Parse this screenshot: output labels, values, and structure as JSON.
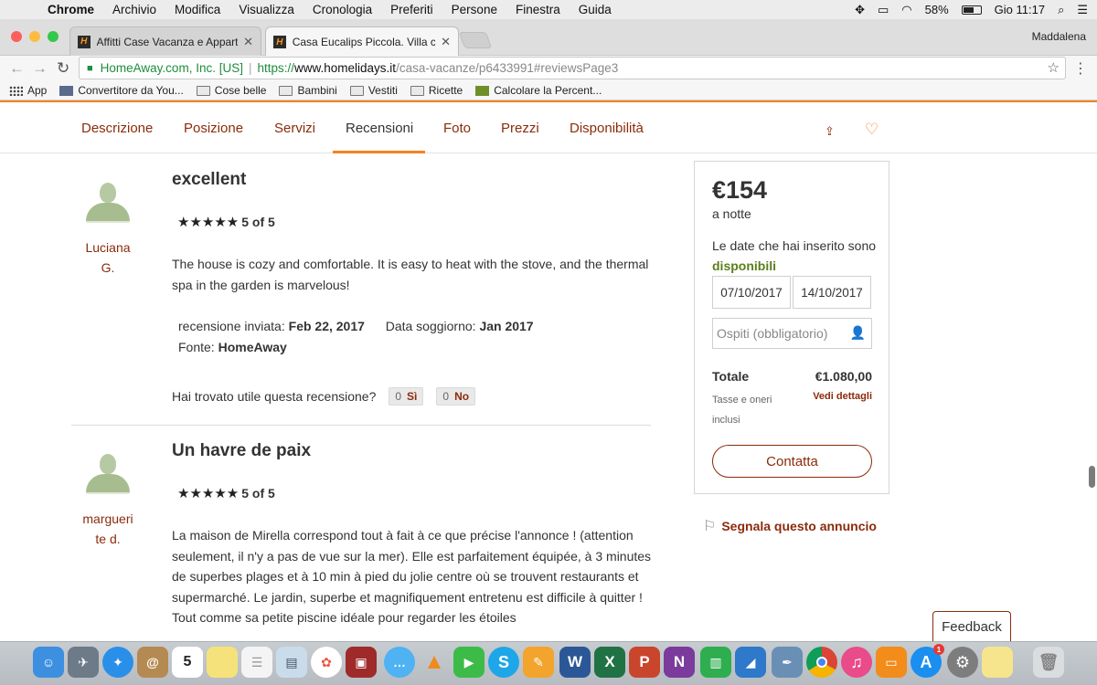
{
  "menubar": {
    "items": [
      "Chrome",
      "Archivio",
      "Modifica",
      "Visualizza",
      "Cronologia",
      "Preferiti",
      "Persone",
      "Finestra",
      "Guida"
    ],
    "battery": "58%",
    "clock": "Gio 11:17"
  },
  "tabs": [
    {
      "title": "Affitti Case Vacanza e Apparta",
      "favicon": "H"
    },
    {
      "title": "Casa Eucalips Piccola. Villa co",
      "favicon": "H"
    }
  ],
  "profile": "Maddalena",
  "address": {
    "org": "HomeAway.com, Inc. [US]",
    "scheme": "https://",
    "host": "www.homelidays.it",
    "path": "/casa-vacanze/p6433991#reviewsPage3"
  },
  "bookmarks": [
    "App",
    "Convertitore da You...",
    "Cose belle",
    "Bambini",
    "Vestiti",
    "Ricette",
    "Calcolare la Percent..."
  ],
  "nav": {
    "items": [
      "Descrizione",
      "Posizione",
      "Servizi",
      "Recensioni",
      "Foto",
      "Prezzi",
      "Disponibilità"
    ],
    "active": "Recensioni"
  },
  "reviews": [
    {
      "reviewer_line1": "Luciana",
      "reviewer_line2": "G.",
      "title": "excellent",
      "stars": "★★★★★",
      "rating": "5 of 5",
      "text": "The house is cozy and comfortable. It is easy to heat with the stove, and the thermal spa in the garden is marvelous!",
      "sent_label": "recensione inviata:",
      "sent_date": "Feb 22, 2017",
      "stay_label": "Data soggiorno:",
      "stay_date": "Jan 2017",
      "source_label": "Fonte:",
      "source": "HomeAway",
      "helpful_q": "Hai trovato utile questa recensione?",
      "yes_count": "0",
      "yes_label": "Sì",
      "no_count": "0",
      "no_label": "No"
    },
    {
      "reviewer_line1": "margueri",
      "reviewer_line2": "te d.",
      "title": "Un havre de paix",
      "stars": "★★★★★",
      "rating": "5 of 5",
      "text": "La maison de Mirella correspond tout à fait à ce que précise l'annonce ! (attention seulement, il n'y a pas de vue sur la mer). Elle est parfaitement équipée, à 3 minutes de superbes plages et à 10 min à pied du jolie centre où se trouvent restaurants et supermarché. Le jardin, superbe et magnifiquement entretenu est difficile à quitter ! Tout comme sa petite piscine idéale pour regarder les étoiles"
    }
  ],
  "booking": {
    "price": "€154",
    "per": "a notte",
    "avail_text": "Le date che hai inserito sono",
    "avail_status": "disponibili",
    "checkin": "07/10/2017",
    "checkout": "14/10/2017",
    "guests_placeholder": "Ospiti (obbligatorio)",
    "total_label": "Totale",
    "total_value": "€1.080,00",
    "tax_note": "Tasse e oneri inclusi",
    "details_link": "Vedi dettagli",
    "contact_label": "Contatta"
  },
  "report_link": "Segnala questo annuncio",
  "feedback_label": "Feedback",
  "dock": {
    "calendar_day": "5",
    "appstore_badge": "1",
    "apps": [
      "finder",
      "launchpad",
      "safari",
      "contacts",
      "calendar",
      "notes",
      "reminders",
      "preview",
      "photos",
      "photo-booth",
      "messages",
      "vlc",
      "facetime",
      "skype",
      "pages",
      "word",
      "excel",
      "powerpoint",
      "onenote",
      "numbers",
      "keynote",
      "preview-2",
      "chrome",
      "itunes",
      "ibooks",
      "app-store",
      "system-preferences",
      "stickies",
      "trash"
    ]
  }
}
